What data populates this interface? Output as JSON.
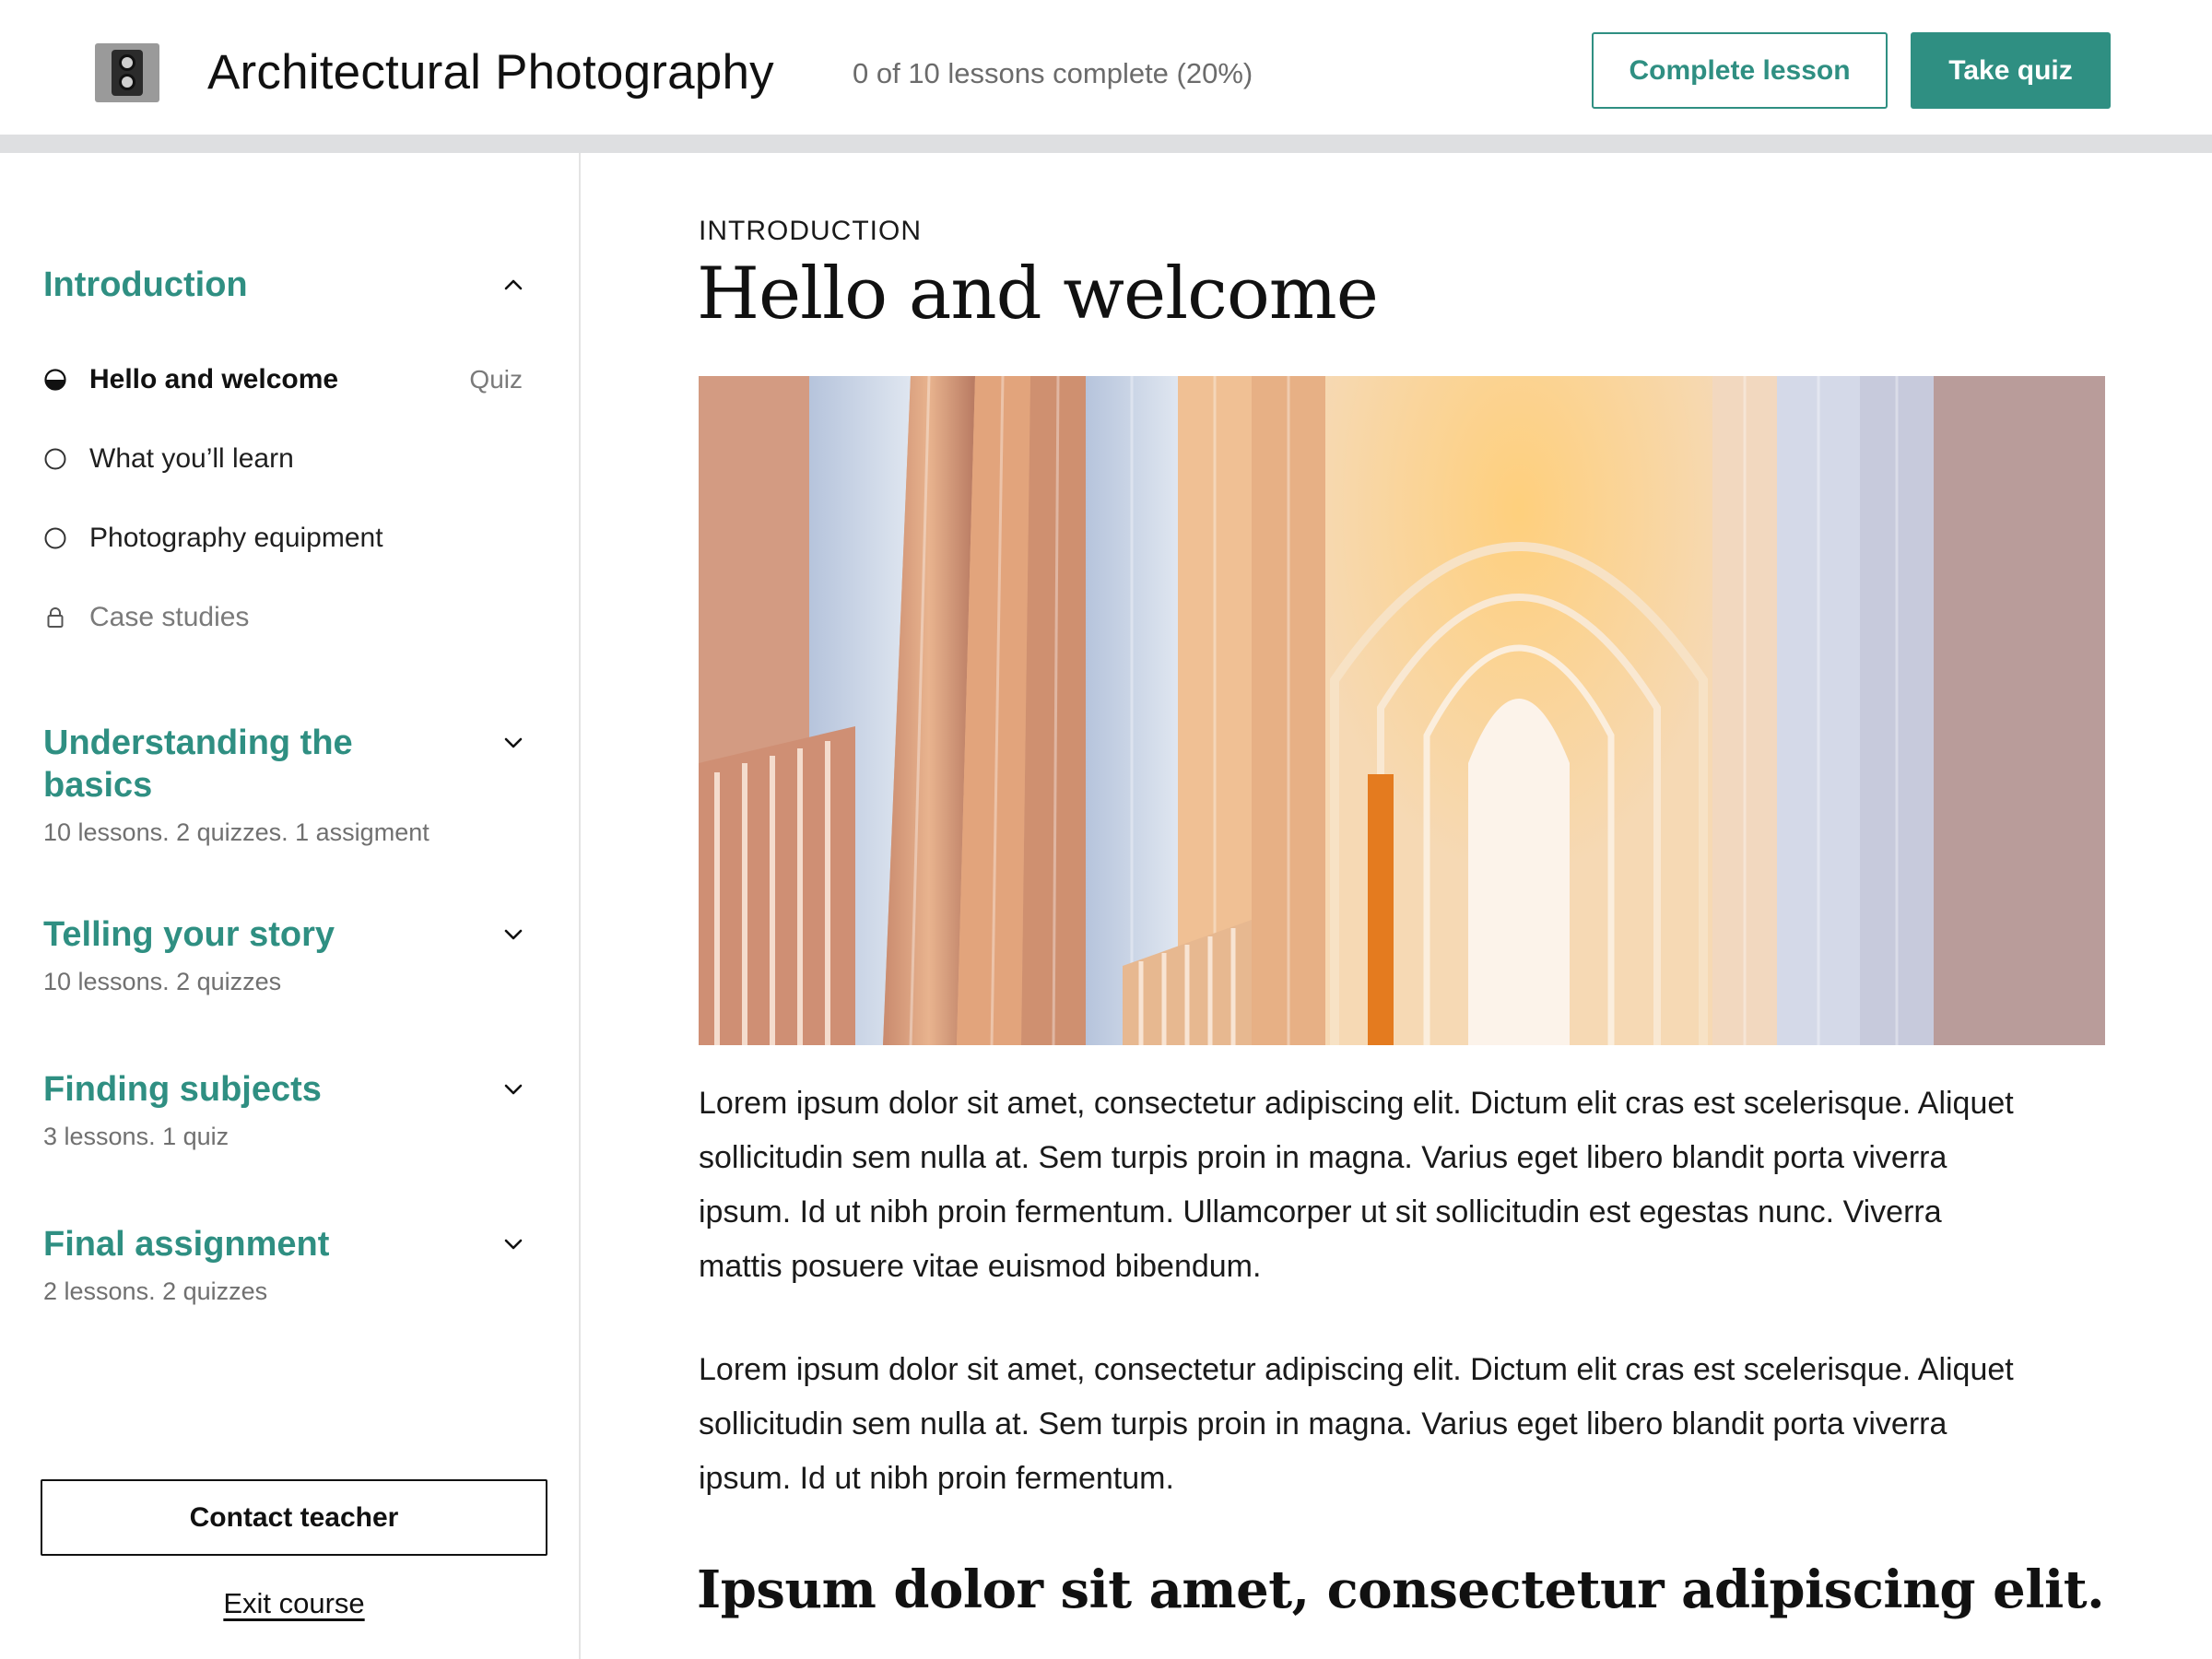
{
  "header": {
    "course_title": "Architectural Photography",
    "progress_text": "0 of 10 lessons complete (20%)",
    "progress_fraction": 0.2,
    "complete_lesson_label": "Complete lesson",
    "take_quiz_label": "Take quiz",
    "logo_icon": "camera-icon"
  },
  "sidebar": {
    "sections": [
      {
        "title": "Introduction",
        "expanded": true,
        "lessons": [
          {
            "label": "Hello and welcome",
            "state": "in-progress",
            "tag": "Quiz"
          },
          {
            "label": "What you’ll learn",
            "state": "not-started"
          },
          {
            "label": "Photography equipment",
            "state": "not-started"
          },
          {
            "label": "Case studies",
            "state": "locked"
          }
        ]
      },
      {
        "title": "Understanding the basics",
        "meta": "10 lessons. 2 quizzes. 1 assigment",
        "expanded": false
      },
      {
        "title": "Telling your story",
        "meta": "10 lessons. 2 quizzes",
        "expanded": false
      },
      {
        "title": "Finding subjects",
        "meta": "3 lessons. 1 quiz",
        "expanded": false
      },
      {
        "title": "Final assignment",
        "meta": "2 lessons. 2 quizzes",
        "expanded": false
      }
    ],
    "contact_label": "Contact teacher",
    "exit_label": "Exit course"
  },
  "main": {
    "eyebrow": "INTRODUCTION",
    "title": "Hello and welcome",
    "paragraphs": [
      "Lorem ipsum dolor sit amet, consectetur adipiscing elit. Dictum elit cras est scelerisque. Aliquet sollicitudin sem nulla at. Sem turpis proin in magna. Varius eget libero blandit porta viverra ipsum. Id ut nibh proin fermentum. Ullamcorper ut sit sollicitudin est egestas nunc. Viverra mattis posuere vitae euismod bibendum.",
      "Lorem ipsum dolor sit amet, consectetur adipiscing elit. Dictum elit cras est scelerisque. Aliquet sollicitudin sem nulla at. Sem turpis proin in magna. Varius eget libero blandit porta viverra ipsum. Id ut nibh proin fermentum."
    ],
    "subheading": "Ipsum dolor sit amet, consectetur adipiscing elit."
  },
  "colors": {
    "accent": "#2f8f82",
    "progress_track": "#dedfe1",
    "muted_text": "#707070"
  }
}
